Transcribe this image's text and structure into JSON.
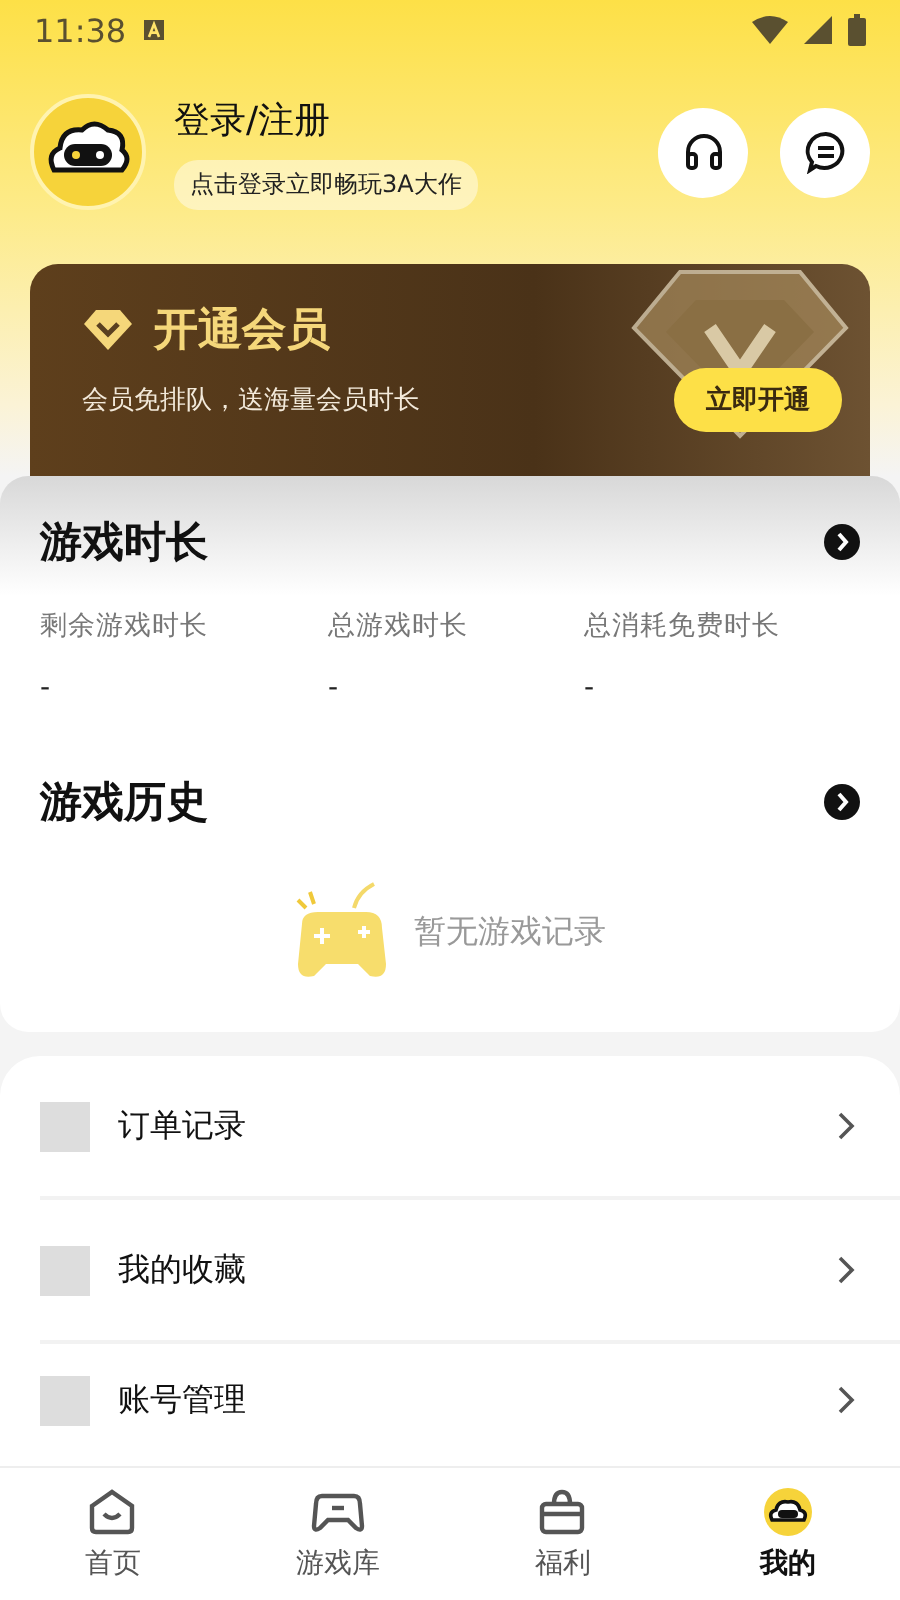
{
  "status_bar": {
    "time": "11:38"
  },
  "profile": {
    "title": "登录/注册",
    "hint": "点击登录立即畅玩3A大作"
  },
  "vip": {
    "title": "开通会员",
    "subtitle": "会员免排队，送海量会员时长",
    "button": "立即开通"
  },
  "play_time": {
    "title": "游戏时长",
    "stats": [
      {
        "label": "剩余游戏时长",
        "value": "-"
      },
      {
        "label": "总游戏时长",
        "value": "-"
      },
      {
        "label": "总消耗免费时长",
        "value": "-"
      }
    ]
  },
  "history": {
    "title": "游戏历史",
    "empty": "暂无游戏记录"
  },
  "menu": [
    {
      "label": "订单记录"
    },
    {
      "label": "我的收藏"
    },
    {
      "label": "账号管理"
    }
  ],
  "tabs": [
    {
      "label": "首页",
      "kind": "home",
      "selected": false
    },
    {
      "label": "游戏库",
      "kind": "games",
      "selected": false
    },
    {
      "label": "福利",
      "kind": "gift",
      "selected": false
    },
    {
      "label": "我的",
      "kind": "me",
      "selected": true
    }
  ]
}
